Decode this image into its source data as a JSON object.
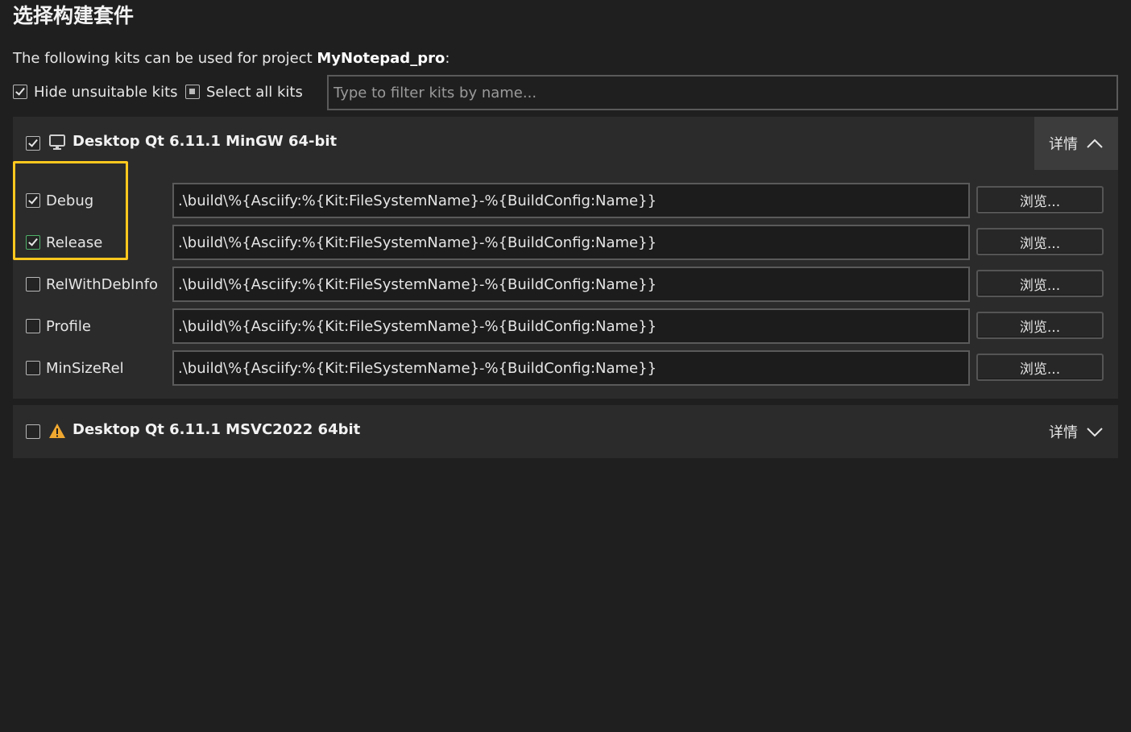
{
  "page": {
    "title": "选择构建套件",
    "intro_prefix": "The following kits can be used for project ",
    "project_name": "MyNotepad_pro",
    "intro_suffix": ":"
  },
  "options": {
    "hide_unsuitable": {
      "label": "Hide unsuitable kits",
      "checked": true
    },
    "select_all": {
      "label": "Select all kits",
      "state": "partial"
    }
  },
  "filter": {
    "placeholder": "Type to filter kits by name...",
    "value": ""
  },
  "kits": [
    {
      "name": "Desktop Qt 6.11.1 MinGW 64-bit",
      "checked": true,
      "icon": "monitor-icon",
      "details_label": "详情",
      "expanded": true,
      "configs": [
        {
          "name": "Debug",
          "checked": true,
          "path": ".\\build\\%{Asciify:%{Kit:FileSystemName}-%{BuildConfig:Name}}",
          "browse_label": "浏览..."
        },
        {
          "name": "Release",
          "checked": true,
          "path": ".\\build\\%{Asciify:%{Kit:FileSystemName}-%{BuildConfig:Name}}",
          "browse_label": "浏览..."
        },
        {
          "name": "RelWithDebInfo",
          "checked": false,
          "path": ".\\build\\%{Asciify:%{Kit:FileSystemName}-%{BuildConfig:Name}}",
          "browse_label": "浏览..."
        },
        {
          "name": "Profile",
          "checked": false,
          "path": ".\\build\\%{Asciify:%{Kit:FileSystemName}-%{BuildConfig:Name}}",
          "browse_label": "浏览..."
        },
        {
          "name": "MinSizeRel",
          "checked": false,
          "path": ".\\build\\%{Asciify:%{Kit:FileSystemName}-%{BuildConfig:Name}}",
          "browse_label": "浏览..."
        }
      ]
    },
    {
      "name": "Desktop Qt 6.11.1 MSVC2022 64bit",
      "checked": false,
      "icon": "warning-icon",
      "details_label": "详情",
      "expanded": false
    }
  ],
  "colors": {
    "background": "#1f1f1f",
    "panel": "#2b2b2b",
    "highlight": "#ffc81e",
    "warning": "#f0a830",
    "check_green": "#4fb36b"
  }
}
